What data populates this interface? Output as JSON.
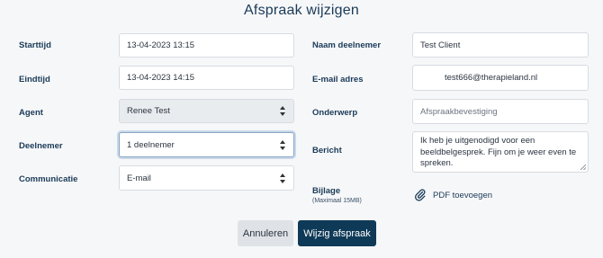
{
  "dialog": {
    "title": "Afspraak wijzigen"
  },
  "left": {
    "starttijd": {
      "label": "Starttijd",
      "value": "13-04-2023 13:15"
    },
    "eindtijd": {
      "label": "Eindtijd",
      "value": "13-04-2023 14:15"
    },
    "agent": {
      "label": "Agent",
      "value": "Renee Test"
    },
    "deelnemer": {
      "label": "Deelnemer",
      "value": "1 deelnemer"
    },
    "communicatie": {
      "label": "Communicatie",
      "value": "E-mail"
    }
  },
  "right": {
    "naam": {
      "label": "Naam deelnemer",
      "value": "Test Client"
    },
    "email": {
      "label": "E-mail adres",
      "value": "test666@therapieland.nl"
    },
    "onderwerp": {
      "label": "Onderwerp",
      "placeholder": "Afspraakbevestiging"
    },
    "bericht": {
      "label": "Bericht",
      "value": "Ik heb je uitgenodigd voor een beeldbelgesprek. Fijn om je weer even te spreken."
    },
    "bijlage": {
      "label": "Bijlage",
      "sublabel": "(Maximaal 15MB)",
      "action": "PDF toevoegen"
    }
  },
  "buttons": {
    "cancel": "Annuleren",
    "submit": "Wijzig afspraak"
  },
  "icons": {
    "attach": "paperclip-icon",
    "select": "select-caret-icon"
  },
  "colors": {
    "primary": "#0f3a57",
    "label": "#1a3a57",
    "background": "#f6f7f9"
  }
}
